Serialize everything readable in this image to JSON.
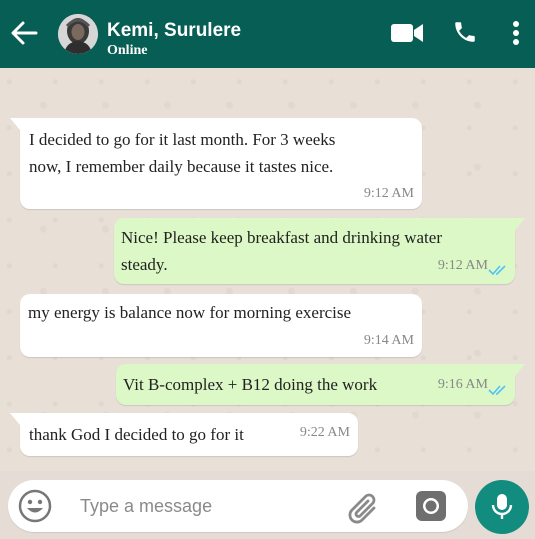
{
  "header": {
    "contact_name": "Kemi, Surulere",
    "status": "Online",
    "icons": [
      "back-arrow-icon",
      "avatar",
      "video-call-icon",
      "phone-icon",
      "more-options-icon"
    ]
  },
  "messages": [
    {
      "direction": "incoming",
      "text_lines": [
        "I decided to go for it last month. For 3 weeks",
        "now, I remember daily because it tastes nice."
      ],
      "time": "9:12 AM"
    },
    {
      "direction": "outgoing",
      "text_lines": [
        "Nice! Please keep breakfast and drinking water",
        "steady."
      ],
      "time": "9:12 AM",
      "ticks": "read"
    },
    {
      "direction": "incoming",
      "text_lines": [
        "my energy is balance now for morning exercise"
      ],
      "time": "9:14 AM"
    },
    {
      "direction": "outgoing",
      "text_lines": [
        "Vit B-complex + B12 doing the work"
      ],
      "time": "9:16 AM",
      "ticks": "read"
    },
    {
      "direction": "incoming",
      "text_lines": [
        "thank God I decided to go for it"
      ],
      "time": "9:22 AM"
    }
  ],
  "composer": {
    "placeholder": "Type a message",
    "value": ""
  },
  "colors": {
    "header": "#075e54",
    "chat_bg": "#e5ddd5",
    "outgoing_bubble": "#dcf8c6",
    "incoming_bubble": "#ffffff",
    "read_ticks": "#4fc3f7",
    "mic_button": "#128c7e"
  }
}
